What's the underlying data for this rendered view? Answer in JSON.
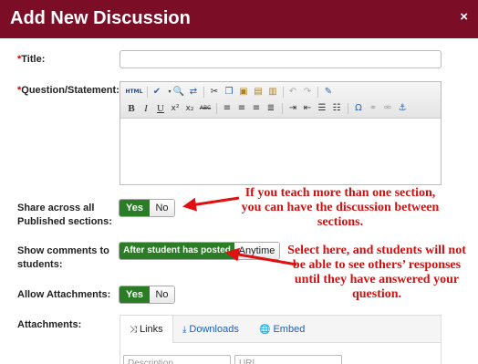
{
  "modal": {
    "title": "Add New Discussion",
    "close": "×"
  },
  "form": {
    "title_label": "Title:",
    "required_mark": "*",
    "question_label": "Question/Statement:",
    "share_label": "Share across all Published sections:",
    "share_yes": "Yes",
    "share_no": "No",
    "show_label": "Show comments to students:",
    "show_after": "After student has posted",
    "show_anytime": "Anytime",
    "attach_allow_label": "Allow Attachments:",
    "attach_yes": "Yes",
    "attach_no": "No",
    "attachments_label": "Attachments:"
  },
  "editor": {
    "toolbar_row1": [
      "HTML",
      "spellcheck",
      "find",
      "replace",
      "cut",
      "copy",
      "paste",
      "paste-text",
      "paste-word",
      "undo",
      "redo",
      "edit"
    ],
    "toolbar_row2": [
      "B",
      "I",
      "U",
      "x²",
      "x₂",
      "ABC",
      "align-left",
      "align-center",
      "align-right",
      "justify",
      "indent",
      "outdent",
      "numbered-list",
      "bullet-list",
      "Ω",
      "link",
      "unlink",
      "anchor"
    ]
  },
  "attachments": {
    "tabs": [
      {
        "label": "Links",
        "icon": "shuffle-icon"
      },
      {
        "label": "Downloads",
        "icon": "download-icon"
      },
      {
        "label": "Embed",
        "icon": "globe-icon"
      }
    ],
    "description_placeholder": "Description",
    "url_placeholder": "URL"
  },
  "annotations": {
    "share_note": "If you teach more than one section, you can have the discussion between sections.",
    "comments_note": "Select here, and students will not be able to see others’ responses until they have answered your question.",
    "arrow_color": "#e01010"
  },
  "colors": {
    "header": "#7b0d27",
    "toggle_on": "#2a7d25",
    "callout_text": "#d01010"
  }
}
